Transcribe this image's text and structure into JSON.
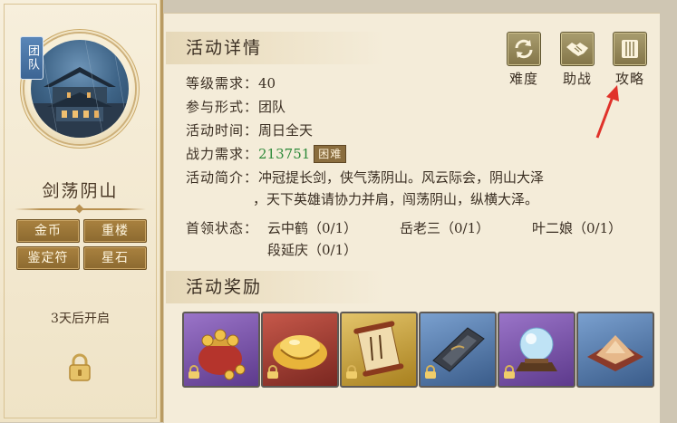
{
  "left_panel": {
    "team_tag": "团队",
    "dungeon_name": "剑荡阴山",
    "loot_tags": [
      "金币",
      "重楼",
      "鉴定符",
      "星石"
    ],
    "open_status": "3天后开启"
  },
  "details": {
    "title": "活动详情",
    "level_req_label": "等级需求：",
    "level_req_value": "40",
    "mode_label": "参与形式：",
    "mode_value": "团队",
    "time_label": "活动时间：",
    "time_value": "周日全天",
    "power_label": "战力需求：",
    "power_value": "213751",
    "power_badge": "困难",
    "intro_label": "活动简介：",
    "intro_line1": "冲冠提长剑，侠气荡阴山。风云际会，阴山大泽",
    "intro_line2": "，天下英雄请协力并肩，闯荡阴山，纵横大泽。",
    "boss_label": "首领状态：",
    "boss1": "云中鹤（0/1）",
    "boss2": "岳老三（0/1）",
    "boss3": "叶二娘（0/1）",
    "boss4": "段延庆（0/1）"
  },
  "top_buttons": [
    "难度",
    "助战",
    "攻略"
  ],
  "rewards": {
    "title": "活动奖励",
    "items": [
      {
        "icon": "coin-pouch-icon",
        "frame": "#7a4fa8"
      },
      {
        "icon": "gold-ingot-icon",
        "frame": "#a8433a"
      },
      {
        "icon": "scroll-icon",
        "frame": "#c09a3c"
      },
      {
        "icon": "inkstone-icon",
        "frame": "#4f78a8"
      },
      {
        "icon": "crystal-ball-icon",
        "frame": "#7a4fa8"
      },
      {
        "icon": "sand-tray-icon",
        "frame": "#4f78a8"
      }
    ]
  },
  "colors": {
    "accent_green": "#2e8a3a",
    "panel_bg": "#f4ecd9",
    "tag_gold": "#a9813f",
    "arrow_red": "#e0322a"
  }
}
